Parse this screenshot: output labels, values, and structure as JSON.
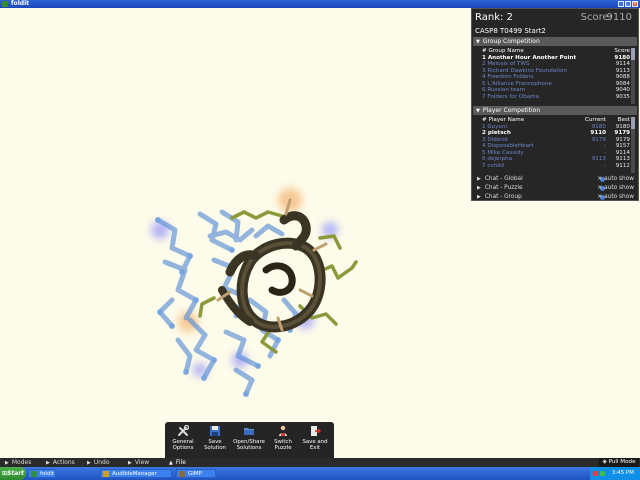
{
  "window": {
    "title": "foldit"
  },
  "panel": {
    "rank_label": "Rank: 2",
    "score_label": "Score:",
    "score_value": "9110",
    "puzzle_name": "CASP8 T0499 Start2",
    "group_competition": {
      "title": "Group Competition",
      "headers": {
        "index": "#",
        "name": "Group Name",
        "score": "Score"
      },
      "rows": [
        {
          "text": "1 Another Hour Another Point",
          "score": "9180",
          "self": true
        },
        {
          "text": "2 Meiosis of TWS",
          "score": "9114",
          "self": false
        },
        {
          "text": "3 Richard Dawkins Foundation",
          "score": "9113",
          "self": false
        },
        {
          "text": "4 Freedom Folders",
          "score": "9088",
          "self": false
        },
        {
          "text": "5 L'Alliance Francophone",
          "score": "9084",
          "self": false
        },
        {
          "text": "6 Russian team",
          "score": "9040",
          "self": false
        },
        {
          "text": "7 Folders for Obama",
          "score": "9035",
          "self": false
        }
      ]
    },
    "player_competition": {
      "title": "Player Competition",
      "headers": {
        "index": "#",
        "name": "Player Name",
        "current": "Current",
        "best": "Best"
      },
      "rows": [
        {
          "text": "1 Guyoni",
          "current": "9180",
          "best": "9180",
          "self": false
        },
        {
          "text": "2 pletsch",
          "current": "9110",
          "best": "9179",
          "self": true
        },
        {
          "text": "3 Diderot",
          "current": "9179",
          "best": "9179",
          "self": false
        },
        {
          "text": "4 DisposableHeart",
          "current": "-",
          "best": "9157",
          "self": false
        },
        {
          "text": "5 Mike Cassidy",
          "current": "-",
          "best": "9114",
          "self": false
        },
        {
          "text": "6 dejerpha",
          "current": "9113",
          "best": "9113",
          "self": false
        },
        {
          "text": "7 cvhild",
          "current": "-",
          "best": "9112",
          "self": false
        }
      ]
    },
    "chats": [
      {
        "label": "Chat - Global",
        "auto": "auto show"
      },
      {
        "label": "Chat - Puzzle",
        "auto": "auto show"
      },
      {
        "label": "Chat - Group",
        "auto": "auto show"
      }
    ]
  },
  "menubar": {
    "items": [
      "Modes",
      "Actions",
      "Undo",
      "View",
      "File"
    ],
    "pull_mode": "Pull Mode"
  },
  "file_menu": {
    "general_options": "General Options",
    "save_solution": "Save Solution",
    "open_share": "Open/Share Solutions",
    "switch_puzzle": "Switch Puzzle",
    "save_exit": "Save and Exit"
  },
  "taskbar": {
    "start": "Start",
    "tasks": [
      "foldit",
      "AudibleManager",
      "GIMP"
    ],
    "clock": "3:45 PM"
  },
  "colors": {
    "background": "#fdfbe9",
    "panel": "#262626",
    "protein_blue": "#5a8fd8",
    "protein_dark": "#3a3424",
    "sidechain_olive": "#8a9a3a",
    "clash_orange": "#f0a050"
  }
}
